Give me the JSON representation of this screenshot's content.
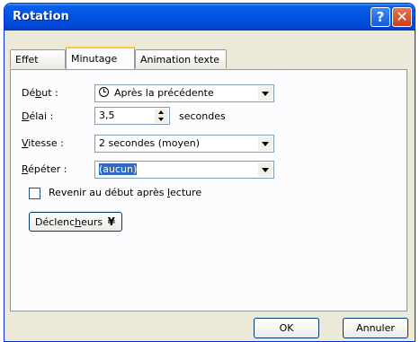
{
  "window": {
    "title": "Rotation",
    "help_glyph": "?",
    "close_glyph": "✕"
  },
  "tabs": [
    {
      "label": "Effet",
      "active": false
    },
    {
      "label": "Minutage",
      "active": true
    },
    {
      "label": "Animation texte",
      "active": false
    }
  ],
  "timing": {
    "debut": {
      "label_pre": "Dé",
      "label_u": "b",
      "label_post": "ut :",
      "value": "Après la précédente"
    },
    "delai": {
      "label_pre": "",
      "label_u": "D",
      "label_post": "élai :",
      "value": "3,5",
      "units": "secondes"
    },
    "vitesse": {
      "label_pre": "",
      "label_u": "V",
      "label_post": "itesse :",
      "value": "2 secondes (moyen)"
    },
    "repeter": {
      "label_pre": "",
      "label_u": "R",
      "label_post": "épéter :",
      "value": "(aucun)"
    },
    "rewind": {
      "label_pre": "Revenir au début après ",
      "label_u": "l",
      "label_post": "ecture",
      "checked": false
    },
    "triggers": {
      "label_pre": "Déclenc",
      "label_u": "h",
      "label_post": "eurs",
      "chevron": "¥"
    }
  },
  "footer": {
    "ok_label": "OK",
    "cancel_label": "Annuler"
  }
}
